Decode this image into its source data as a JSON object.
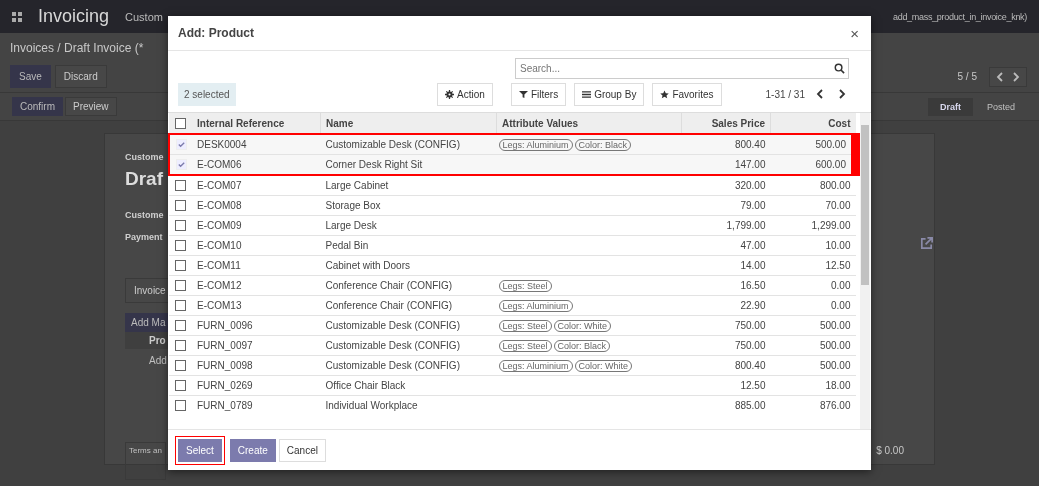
{
  "app": {
    "title": "Invoicing",
    "menu_item": "Custom",
    "user": "add_mass_product_in_invoice_knk)"
  },
  "background": {
    "breadcrumb": "Invoices / Draft Invoice (*",
    "save": "Save",
    "discard": "Discard",
    "confirm": "Confirm",
    "preview": "Preview",
    "pager": "5 / 5",
    "stages": [
      {
        "label": "Draft",
        "selected": true
      },
      {
        "label": "Posted",
        "selected": false
      }
    ],
    "sheet": {
      "customer_caption": "Custome",
      "title": "Draf",
      "customer_label": "Custome",
      "payment_label": "Payment",
      "tab": "Invoice",
      "add_button": "Add Ma",
      "column": "Pro",
      "add_line": "Add",
      "terms": "Terms an",
      "total": "$ 0.00"
    }
  },
  "dialog": {
    "title": "Add: Product",
    "close": "×",
    "search": {
      "placeholder": "Search..."
    },
    "selection_count": "2 selected",
    "action": "Action",
    "filters": "Filters",
    "group_by": "Group By",
    "favorites": "Favorites",
    "pager": "1-31 / 31",
    "select_all_checked": false,
    "columns": [
      "Internal Reference",
      "Name",
      "Attribute Values",
      "Sales Price",
      "Cost"
    ],
    "rows": [
      {
        "ref": "DESK0004",
        "name": "Customizable Desk (CONFIG)",
        "attributes": [
          "Legs: Aluminium",
          "Color: Black"
        ],
        "price": "800.40",
        "cost": "500.00",
        "selected": true
      },
      {
        "ref": "E-COM06",
        "name": "Corner Desk Right Sit",
        "attributes": [],
        "price": "147.00",
        "cost": "600.00",
        "selected": true
      },
      {
        "ref": "E-COM07",
        "name": "Large Cabinet",
        "attributes": [],
        "price": "320.00",
        "cost": "800.00",
        "selected": false
      },
      {
        "ref": "E-COM08",
        "name": "Storage Box",
        "attributes": [],
        "price": "79.00",
        "cost": "70.00",
        "selected": false
      },
      {
        "ref": "E-COM09",
        "name": "Large Desk",
        "attributes": [],
        "price": "1,799.00",
        "cost": "1,299.00",
        "selected": false
      },
      {
        "ref": "E-COM10",
        "name": "Pedal Bin",
        "attributes": [],
        "price": "47.00",
        "cost": "10.00",
        "selected": false
      },
      {
        "ref": "E-COM11",
        "name": "Cabinet with Doors",
        "attributes": [],
        "price": "14.00",
        "cost": "12.50",
        "selected": false
      },
      {
        "ref": "E-COM12",
        "name": "Conference Chair (CONFIG)",
        "attributes": [
          "Legs: Steel"
        ],
        "price": "16.50",
        "cost": "0.00",
        "selected": false
      },
      {
        "ref": "E-COM13",
        "name": "Conference Chair (CONFIG)",
        "attributes": [
          "Legs: Aluminium"
        ],
        "price": "22.90",
        "cost": "0.00",
        "selected": false
      },
      {
        "ref": "FURN_0096",
        "name": "Customizable Desk (CONFIG)",
        "attributes": [
          "Legs: Steel",
          "Color: White"
        ],
        "price": "750.00",
        "cost": "500.00",
        "selected": false
      },
      {
        "ref": "FURN_0097",
        "name": "Customizable Desk (CONFIG)",
        "attributes": [
          "Legs: Steel",
          "Color: Black"
        ],
        "price": "750.00",
        "cost": "500.00",
        "selected": false
      },
      {
        "ref": "FURN_0098",
        "name": "Customizable Desk (CONFIG)",
        "attributes": [
          "Legs: Aluminium",
          "Color: White"
        ],
        "price": "800.40",
        "cost": "500.00",
        "selected": false
      },
      {
        "ref": "FURN_0269",
        "name": "Office Chair Black",
        "attributes": [],
        "price": "12.50",
        "cost": "18.00",
        "selected": false
      },
      {
        "ref": "FURN_0789",
        "name": "Individual Workplace",
        "attributes": [],
        "price": "885.00",
        "cost": "876.00",
        "selected": false
      }
    ],
    "buttons": [
      {
        "label": "Select",
        "kind": "primary",
        "highlighted": true
      },
      {
        "label": "Create",
        "kind": "primary",
        "highlighted": false
      },
      {
        "label": "Cancel",
        "kind": "secondary",
        "highlighted": false
      }
    ]
  }
}
